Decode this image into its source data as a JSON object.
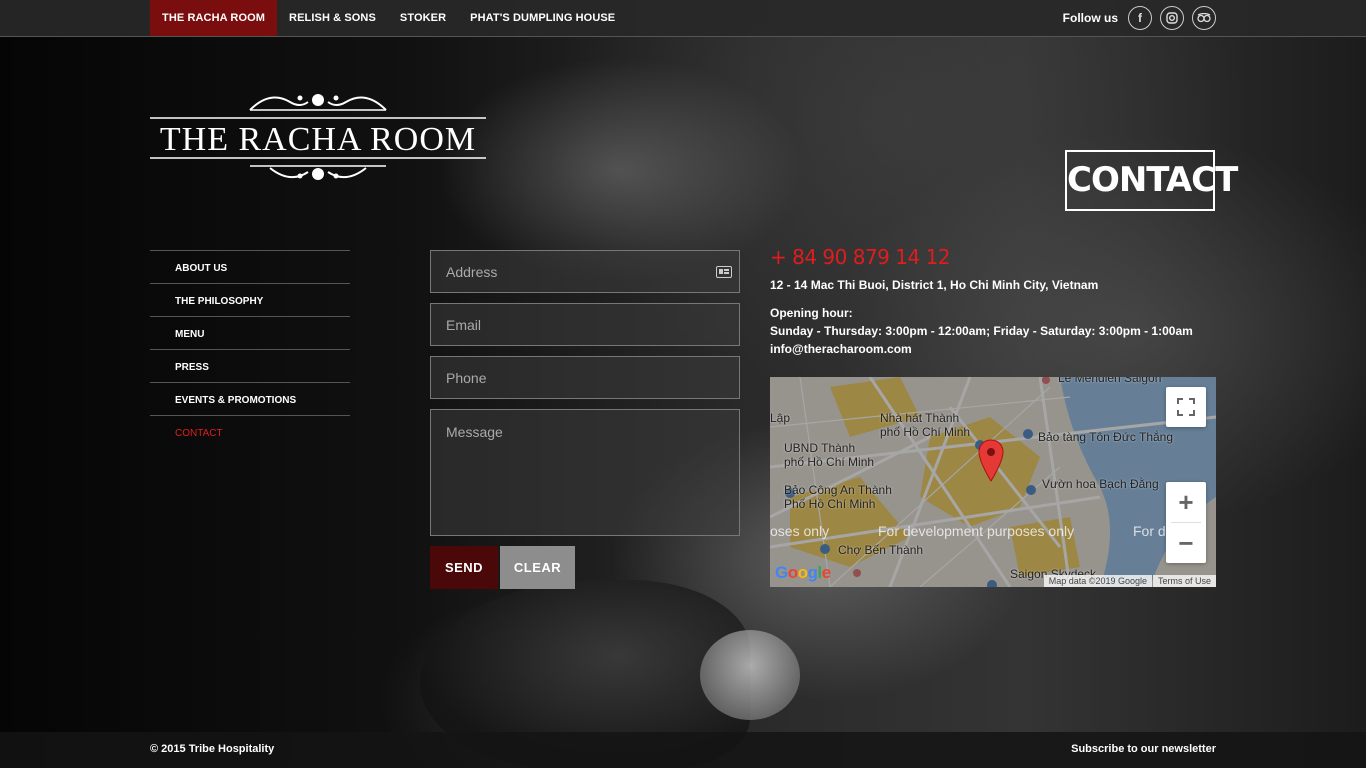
{
  "topnav": {
    "items": [
      {
        "label": "THE RACHA ROOM",
        "active": true
      },
      {
        "label": "RELISH & SONS",
        "active": false
      },
      {
        "label": "STOKER",
        "active": false
      },
      {
        "label": "PHAT'S DUMPLING HOUSE",
        "active": false
      }
    ],
    "follow_label": "Follow us",
    "social": [
      {
        "name": "facebook-icon",
        "glyph": "f"
      },
      {
        "name": "instagram-icon",
        "glyph": "◎"
      },
      {
        "name": "tripadvisor-icon",
        "glyph": "ꝏ"
      }
    ]
  },
  "logo": {
    "text": "THE RACHA ROOM"
  },
  "page_title": "CONTACT",
  "sidemenu": {
    "items": [
      {
        "label": "ABOUT US"
      },
      {
        "label": "THE PHILOSOPHY"
      },
      {
        "label": "MENU"
      },
      {
        "label": "PRESS"
      },
      {
        "label": "EVENTS & PROMOTIONS"
      },
      {
        "label": "CONTACT"
      }
    ],
    "current": "CONTACT"
  },
  "form": {
    "address_placeholder": "Address",
    "email_placeholder": "Email",
    "phone_placeholder": "Phone",
    "message_placeholder": "Message",
    "send_label": "SEND",
    "clear_label": "CLEAR"
  },
  "info": {
    "phone": "+ 84 90 879 14 12",
    "address": "12 - 14 Mac Thi Buoi, District 1, Ho Chi Minh City, Vietnam",
    "hours_label": "Opening hour:",
    "hours": "Sunday - Thursday: 3:00pm - 12:00am; Friday - Saturday: 3:00pm - 1:00am",
    "email": "info@theracharoom.com"
  },
  "map": {
    "labels": [
      "Lập",
      "Nhà hát Thành",
      "phố Hồ Chí Minh",
      "UBND Thành",
      "phố Hồ Chí Minh",
      "Bảo tàng Tôn Đức Thắng",
      "Bảo Công An Thành",
      "Phố Hồ Chí Minh",
      "Vườn hoa Bạch Đằng",
      "Chợ Bến Thành",
      "Saigon Skydeck",
      "Le Meridien Saigon"
    ],
    "dev_watermark": "For development purposes only",
    "dev_left": "oses only",
    "dev_right": "For d",
    "google_label": "Google",
    "attribution": "Map data ©2019 Google",
    "terms": "Terms of Use",
    "colors": {
      "water": "#9dc4e8",
      "blocks": "#f2d06b",
      "land": "#e8e4da"
    }
  },
  "footer": {
    "copyright": "© 2015 Tribe Hospitality",
    "newsletter": "Subscribe to our newsletter"
  },
  "colors": {
    "accent_red": "#e01d1d",
    "active_nav": "#7a0d0d",
    "send_button": "#4a0808",
    "clear_button": "#8d8d8d"
  }
}
